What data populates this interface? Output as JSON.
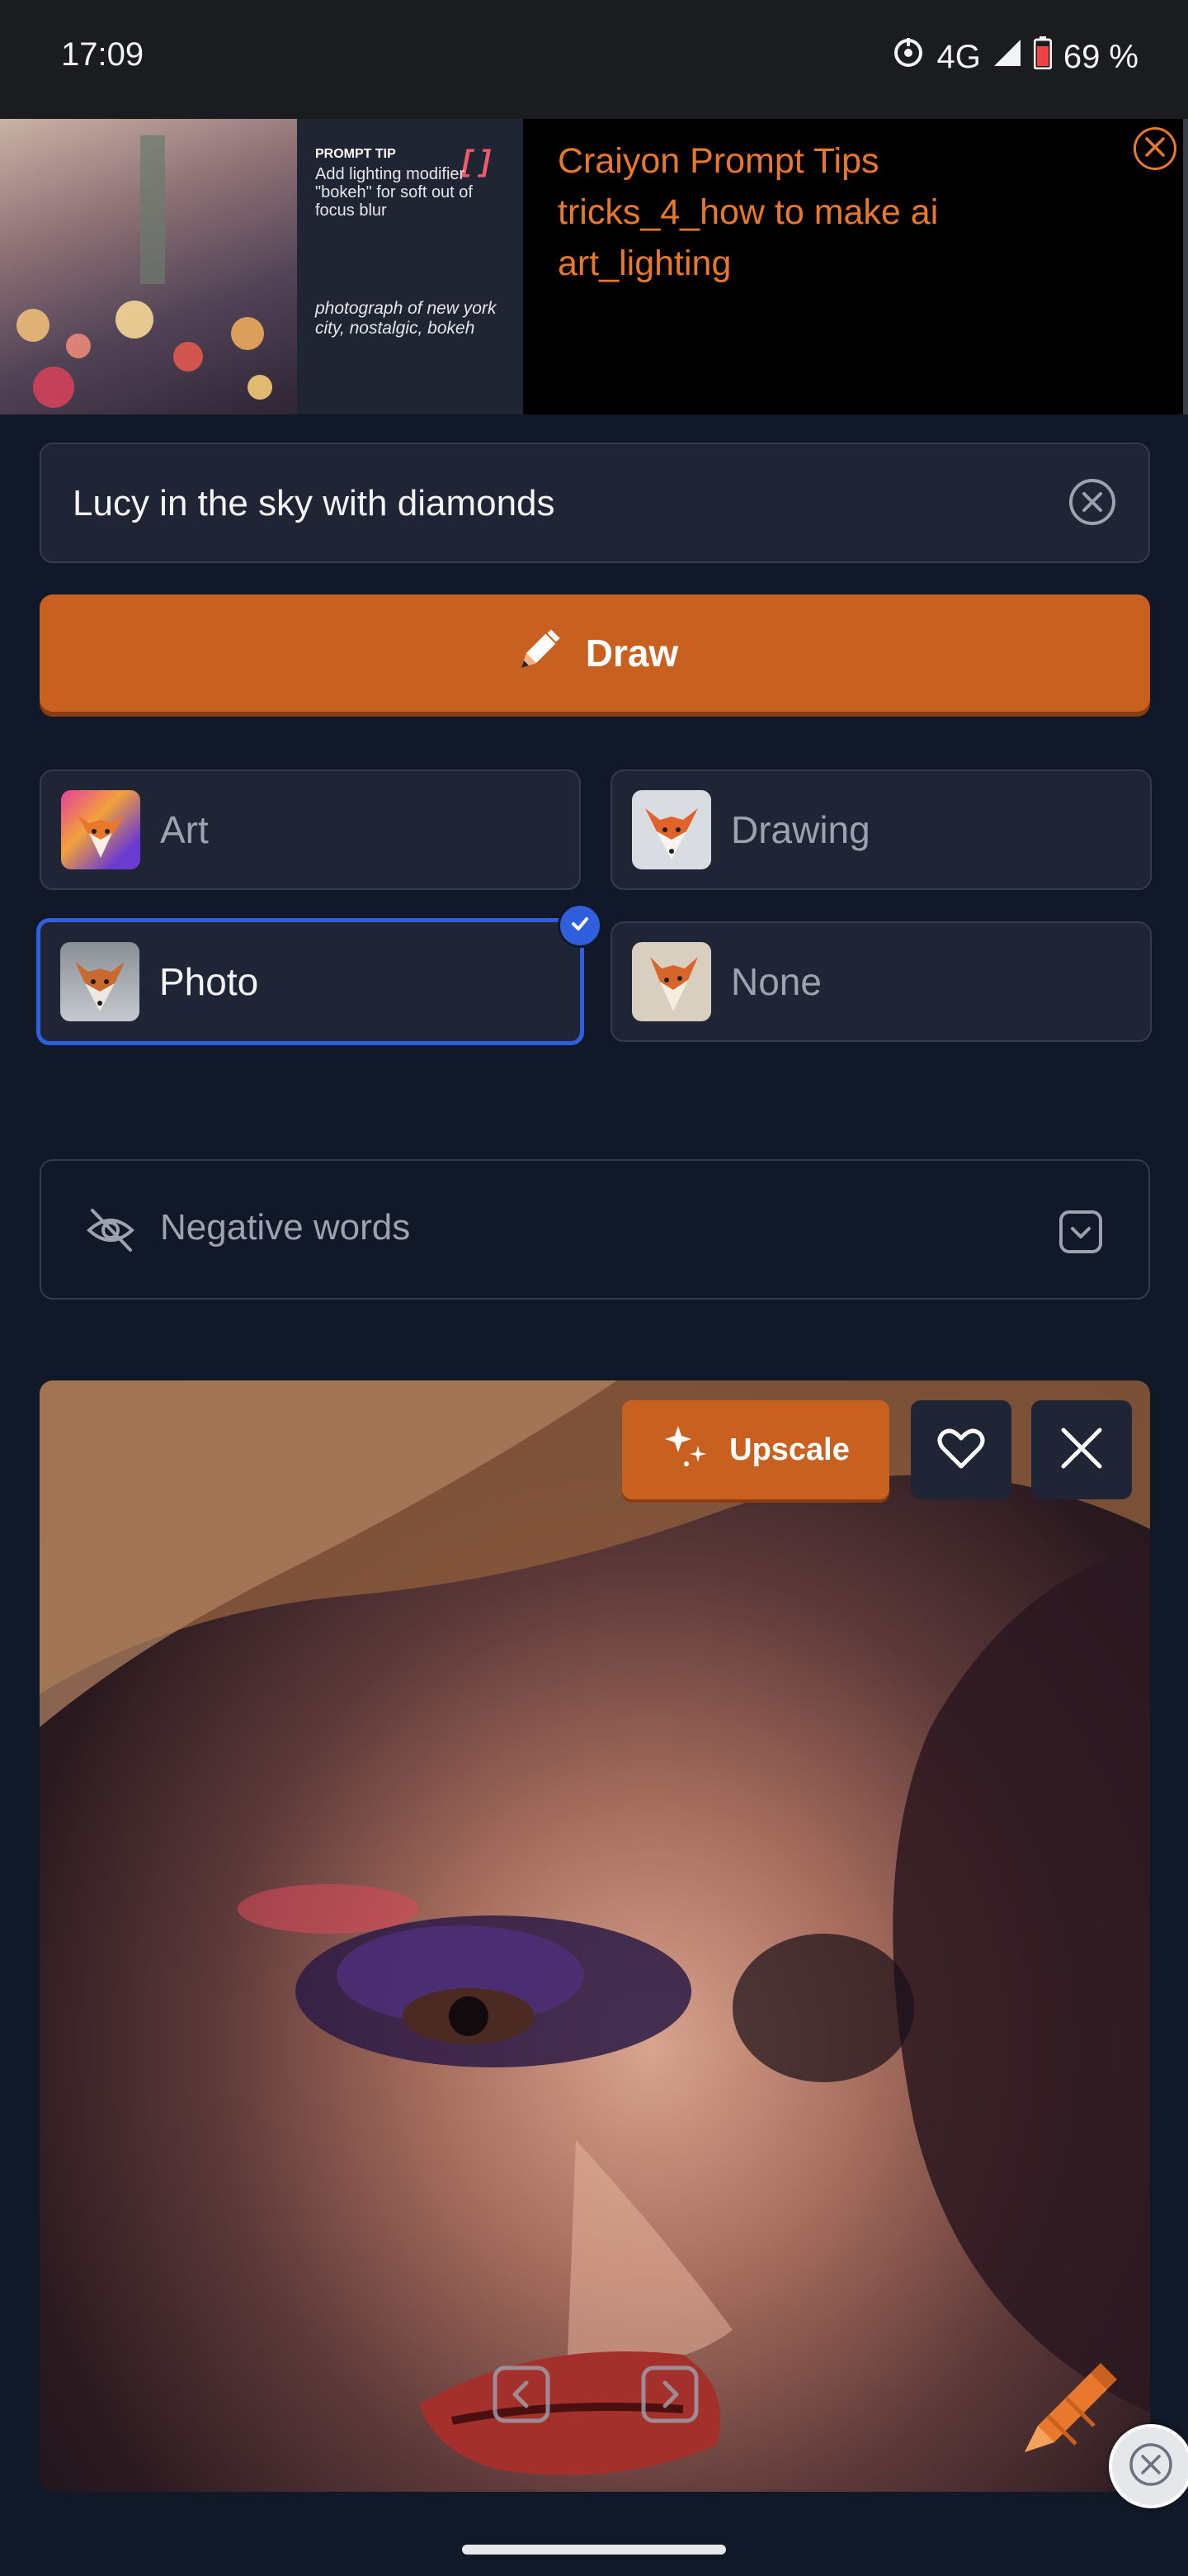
{
  "status_bar": {
    "time": "17:09",
    "network": "4G",
    "battery": "69 %"
  },
  "ad": {
    "tip_title": "PROMPT TIP",
    "tip_brackets": "[ ]",
    "tip_body": "Add lighting modifier \"bokeh\" for soft out of focus blur",
    "tip_example": "photograph of new york city, nostalgic, bokeh",
    "headline": "Craiyon Prompt Tips tricks_4_how to make ai art_lighting",
    "accent_color": "#e8782c"
  },
  "prompt": {
    "value": "Lucy in the sky with diamonds"
  },
  "draw_button": {
    "label": "Draw",
    "color": "#c8611f"
  },
  "styles": {
    "options": [
      {
        "label": "Art",
        "selected": false
      },
      {
        "label": "Drawing",
        "selected": false
      },
      {
        "label": "Photo",
        "selected": true
      },
      {
        "label": "None",
        "selected": false
      }
    ],
    "selected_color": "#2f5fdc"
  },
  "negative_words": {
    "label": "Negative words"
  },
  "result": {
    "upscale_label": "Upscale"
  }
}
